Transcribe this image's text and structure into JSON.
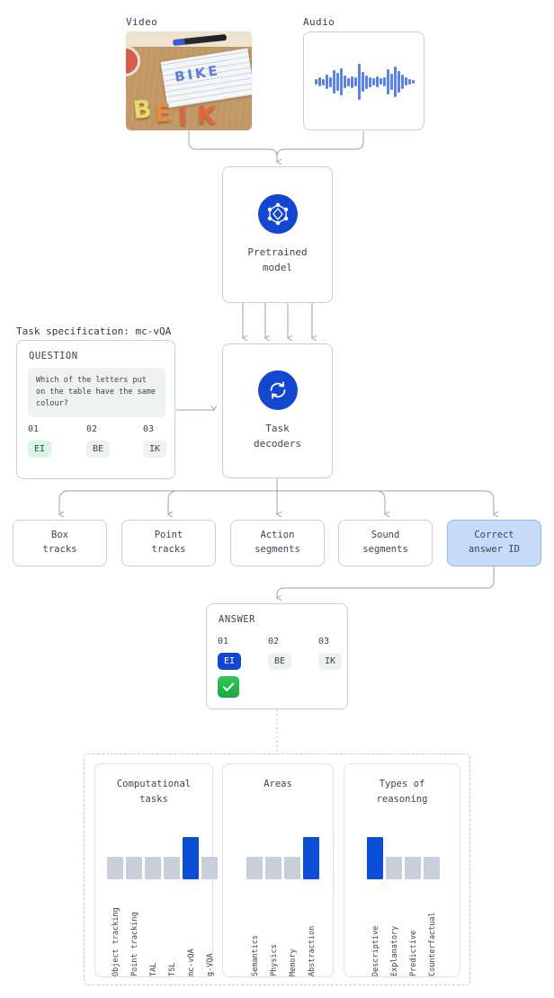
{
  "inputs": {
    "video_label": "Video",
    "audio_label": "Audio",
    "video_scene": {
      "written_word": "BIKE",
      "letter_blocks": [
        "B",
        "E",
        "I",
        "K"
      ]
    }
  },
  "pipeline": {
    "pretrained_model": {
      "line1": "Pretrained",
      "line2": "model",
      "icon": "graph-network-icon"
    },
    "task_decoders": {
      "line1": "Task",
      "line2": "decoders",
      "icon": "sync-circle-icon"
    }
  },
  "task_spec": {
    "label": "Task specification: mc-vQA",
    "question_heading": "QUESTION",
    "question_text": "Which of the letters put on the table have the same colour?",
    "options": [
      {
        "id": "01",
        "text": "EI",
        "highlighted": true
      },
      {
        "id": "02",
        "text": "BE",
        "highlighted": false
      },
      {
        "id": "03",
        "text": "IK",
        "highlighted": false
      }
    ]
  },
  "outputs": [
    {
      "line1": "Box",
      "line2": "tracks",
      "selected": false
    },
    {
      "line1": "Point",
      "line2": "tracks",
      "selected": false
    },
    {
      "line1": "Action",
      "line2": "segments",
      "selected": false
    },
    {
      "line1": "Sound",
      "line2": "segments",
      "selected": false
    },
    {
      "line1": "Correct",
      "line2": "answer ID",
      "selected": true
    }
  ],
  "answer": {
    "heading": "ANSWER",
    "options": [
      {
        "id": "01",
        "text": "EI",
        "selected": true
      },
      {
        "id": "02",
        "text": "BE",
        "selected": false
      },
      {
        "id": "03",
        "text": "IK",
        "selected": false
      }
    ],
    "check_icon": "check-mark-icon"
  },
  "colors": {
    "accent_blue": "#0b4fd8",
    "icon_blue": "#1346d1",
    "selected_box_fill": "#c6dcf8",
    "selected_box_border": "#8fb7ee",
    "bar_grey": "#c8cfdb",
    "chip_grey": "#edf2f0",
    "chip_green": "#d6f7e4",
    "check_green": "#22c55e",
    "waveform_blue": "#5b82e8",
    "wire_grey": "#9aa3b2"
  },
  "chart_data": [
    {
      "type": "bar",
      "title": "Computational tasks",
      "categories": [
        "Object tracking",
        "Point tracking",
        "TAL",
        "TSL",
        "mc-vQA",
        "g-VQA"
      ],
      "values": [
        1,
        1,
        1,
        1,
        2,
        1
      ],
      "highlight_index": 4,
      "ylim": [
        0,
        2
      ],
      "xlabel": "",
      "ylabel": "",
      "grid": false,
      "legend": "none"
    },
    {
      "type": "bar",
      "title": "Areas",
      "categories": [
        "Semantics",
        "Physics",
        "Memory",
        "Abstraction"
      ],
      "values": [
        1,
        1,
        1,
        2
      ],
      "highlight_index": 3,
      "ylim": [
        0,
        2
      ],
      "xlabel": "",
      "ylabel": "",
      "grid": false,
      "legend": "none"
    },
    {
      "type": "bar",
      "title": "Types of reasoning",
      "categories": [
        "Descriptive",
        "Explanatory",
        "Predictive",
        "Counterfactual"
      ],
      "values": [
        2,
        1,
        1,
        1
      ],
      "highlight_index": 0,
      "ylim": [
        0,
        2
      ],
      "xlabel": "",
      "ylabel": "",
      "grid": false,
      "legend": "none"
    }
  ]
}
